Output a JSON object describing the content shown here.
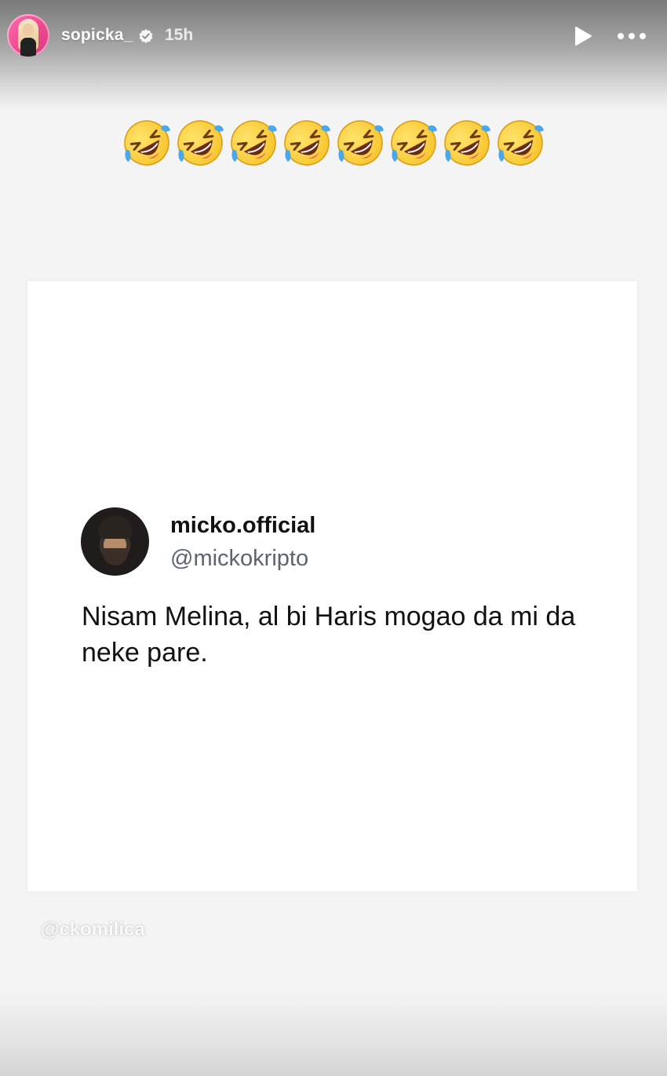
{
  "header": {
    "username": "sopicka_",
    "timestamp": "15h",
    "verified": true,
    "avatar_icon": "profile-avatar",
    "play_icon": "play-icon",
    "more_icon": "more-options-icon"
  },
  "story": {
    "emoji_row": {
      "emoji": "rolling-on-the-floor-laughing",
      "count": 8
    },
    "shared_post": {
      "display_name": "micko.official",
      "handle": "@mickokripto",
      "text": "Nisam Melina, al bi Haris mogao da mi da neke pare."
    },
    "mention_tag": "@ckomilica"
  },
  "colors": {
    "background": "#f4f4f4",
    "card": "#ffffff",
    "emoji_yellow": "#f7c52d",
    "tear_blue": "#4aa8e8",
    "handle_gray": "#5b6470"
  }
}
